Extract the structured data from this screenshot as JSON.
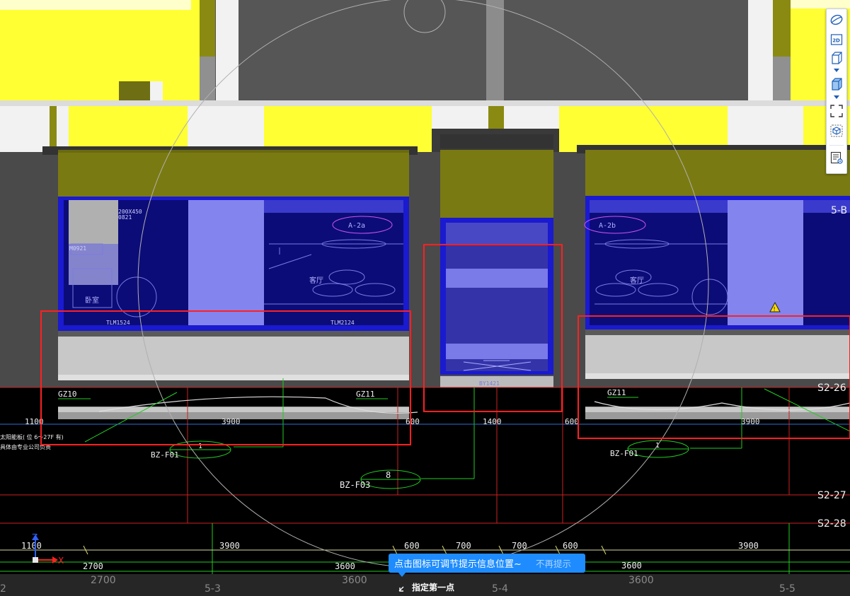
{
  "viewport": {
    "room_labels": {
      "a2a": "A-2a",
      "a2b": "A-2b",
      "living_left": "客厅",
      "living_right": "客厅",
      "bedroom": "卧室"
    },
    "faint_labels": {
      "d1": "TLM1524",
      "d2": "TLM2124",
      "d3": "BY1421",
      "d4": "M0921",
      "d5": "200X450",
      "d6": "0821"
    },
    "column_labels": {
      "gz10": "GZ10",
      "gz11_left": "GZ11",
      "gz11_right": "GZ11"
    },
    "callouts": [
      {
        "num": "1",
        "tag": "BZ-F01"
      },
      {
        "num": "8",
        "tag": "BZ-F03"
      },
      {
        "num": "1",
        "tag": "BZ-F01"
      }
    ],
    "notes": {
      "line1": "太阳能板( 位 6～27F 有)",
      "line2": "具体由专业公司负责"
    },
    "dims_row1": {
      "a": "1100",
      "b": "3900",
      "c": "600",
      "d": "1400",
      "e": "600",
      "f": "3900"
    },
    "dims_row2": {
      "a": "1100",
      "b": "3900",
      "c": "600",
      "d": "700",
      "e": "700",
      "f": "600",
      "g": "3900"
    },
    "dims_row3": {
      "a": "2700",
      "b": "3600",
      "c": "3600"
    },
    "dims_row4": {
      "a": "2700",
      "b": "3600",
      "c": "3600"
    },
    "axis_labels": {
      "s2_26": "S2-26",
      "s2_27": "S2-27",
      "s2_28": "S2-28",
      "b5": "5-B"
    },
    "grid_labels": {
      "g2": "2",
      "g53": "5-3",
      "g54": "5-4",
      "g55": "5-5"
    },
    "ucs": {
      "x": "X",
      "z": "Z"
    }
  },
  "toolbar": {
    "buttons": [
      {
        "icon": "orbit-icon"
      },
      {
        "icon": "2d-view-icon",
        "label": "2D"
      },
      {
        "icon": "3d-box-icon"
      },
      {
        "icon": "3d-box-solid-icon"
      },
      {
        "icon": "zoom-extents-icon"
      },
      {
        "icon": "isolate-view-icon"
      },
      {
        "icon": "properties-view-icon"
      }
    ]
  },
  "tip": {
    "message": "点击图标可调节提示信息位置~",
    "dismiss": "不再提示"
  },
  "prompt": {
    "text": "指定第一点"
  },
  "colors": {
    "accent": "#1e8cff",
    "selection": "#ff2020",
    "wall_yellow": "#ffff33",
    "olive": "#7a7a12",
    "glass": "#0c0c78"
  }
}
